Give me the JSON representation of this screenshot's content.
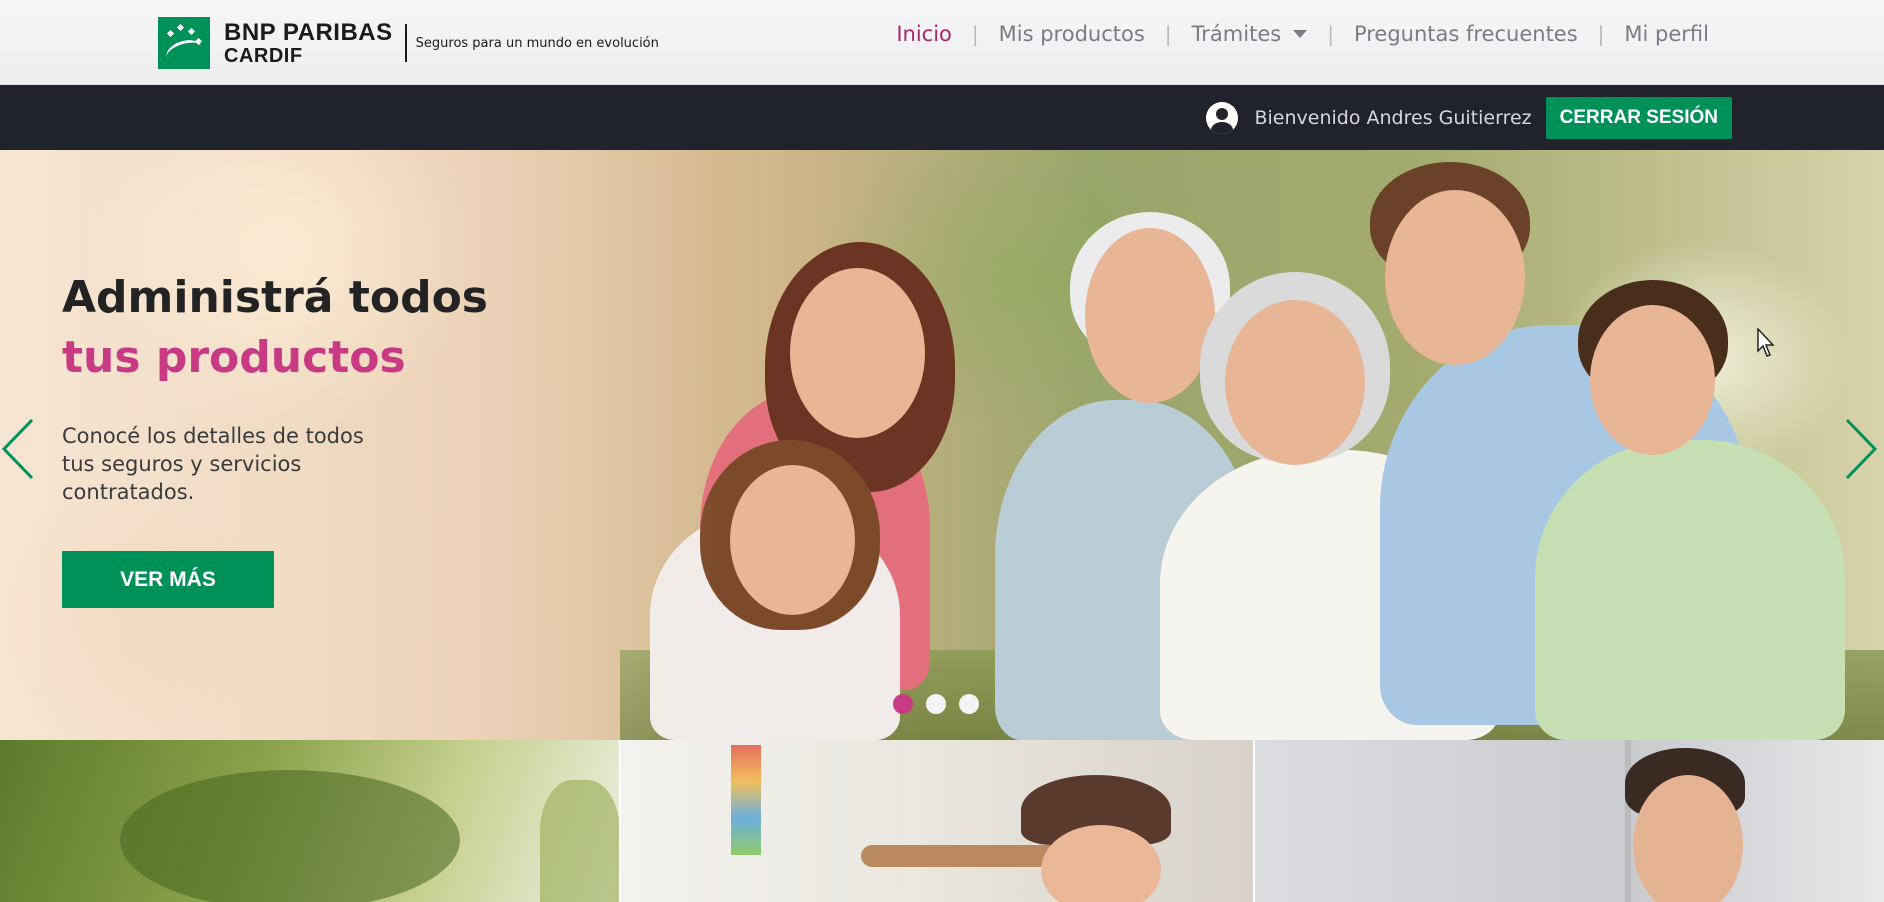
{
  "brand": {
    "name_line1": "BNP PARIBAS",
    "name_line2": "CARDIF",
    "tagline": "Seguros para un mundo en evolución",
    "color": "#00915a"
  },
  "nav": {
    "items": [
      {
        "label": "Inicio",
        "active": true
      },
      {
        "label": "Mis productos",
        "active": false
      },
      {
        "label": "Trámites",
        "active": false,
        "has_dropdown": true
      },
      {
        "label": "Preguntas frecuentes",
        "active": false
      },
      {
        "label": "Mi perfil",
        "active": false
      }
    ],
    "active_color": "#a6296a",
    "separator": "|"
  },
  "userbar": {
    "welcome_text": "Bienvenido Andres Guitierrez",
    "logout_label": "CERRAR SESIÓN",
    "user_icon": "user-circle-icon"
  },
  "hero": {
    "title_line1": "Administrá todos",
    "title_line2": "tus productos",
    "description": "Conocé los detalles de todos tus seguros y servicios contratados.",
    "cta_label": "VER MÁS",
    "accent_color": "#c83a83",
    "slides_count": 3,
    "active_slide": 1,
    "prev_icon": "chevron-left-icon",
    "next_icon": "chevron-right-icon"
  },
  "tiles": [
    {
      "name": "product-tile-1"
    },
    {
      "name": "product-tile-2"
    },
    {
      "name": "product-tile-3"
    }
  ]
}
